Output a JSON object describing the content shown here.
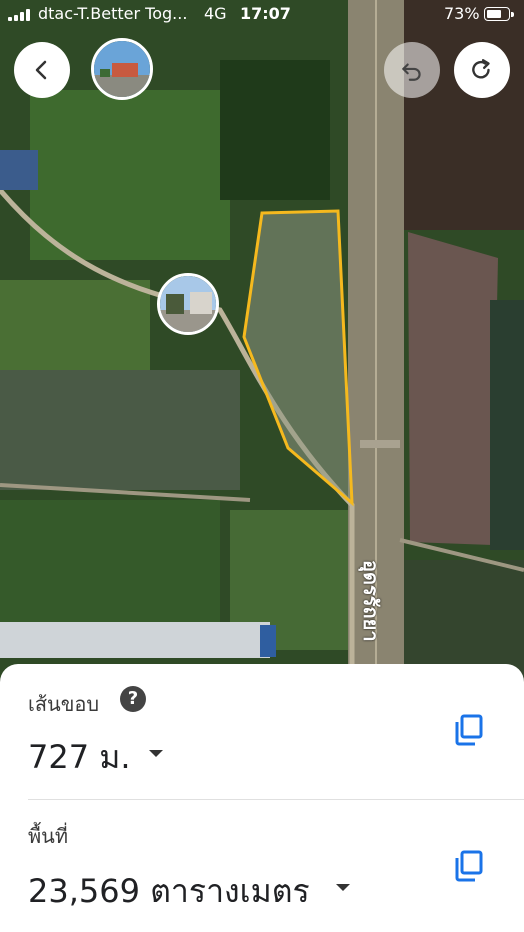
{
  "status_bar": {
    "carrier": "dtac-T.Better Tog...",
    "network": "4G",
    "time": "17:07",
    "battery_percent_text": "73%",
    "battery_level": 0.73
  },
  "map": {
    "road_label": "อุดรรัถยา",
    "polygon_color": "#f5b91e",
    "icons": {
      "back": "chevron-left-icon",
      "undo": "undo-icon",
      "redo": "redo-icon"
    }
  },
  "sheet": {
    "perimeter_label": "เส้นขอบ",
    "perimeter_value": "727 ม.",
    "area_label": "พื้นที่",
    "area_value": "23,569 ตารางเมตร",
    "help_glyph": "?",
    "accent_color": "#1a73e8"
  }
}
